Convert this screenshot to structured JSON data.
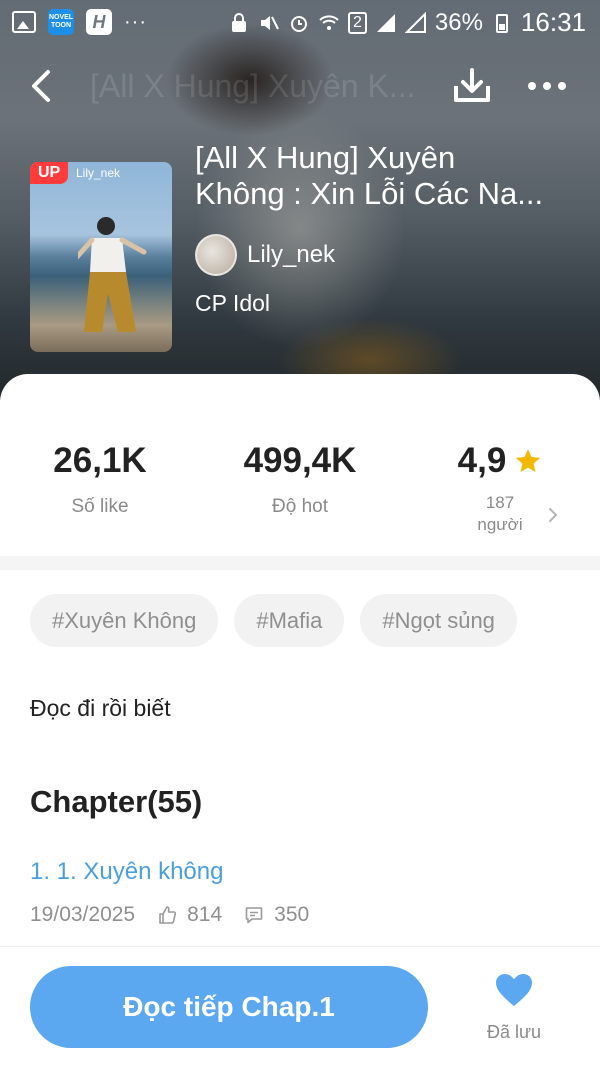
{
  "status_bar": {
    "app_icons": [
      "gallery-icon",
      "novel-toon-icon",
      "h-app-icon"
    ],
    "novel_toon_text": "NOVEL TOON",
    "h_app_text": "H",
    "more_dots": "···",
    "sim_slot": "2",
    "battery_percent": "36%",
    "time": "16:31"
  },
  "nav": {
    "title": "[All X Hung] Xuyên K..."
  },
  "book": {
    "cover_badge": "UP",
    "cover_author": "Lily_nek",
    "title_line1": "[All X Hung] Xuyên",
    "title_line2": "Không : Xin Lỗi Các Na...",
    "author": "Lily_nek",
    "category": "CP Idol"
  },
  "stats": {
    "likes": {
      "value": "26,1K",
      "label": "Số like"
    },
    "hot": {
      "value": "499,4K",
      "label": "Độ hot"
    },
    "rating": {
      "value": "4,9",
      "count": "187",
      "count_label": "người"
    }
  },
  "tags": [
    "#Xuyên Không",
    "#Mafia",
    "#Ngọt sủng"
  ],
  "description": "Đọc đi rồi biết",
  "chapters": {
    "heading": "Chapter(55)",
    "latest": {
      "title": "1. 1. Xuyên không",
      "date": "19/03/2025",
      "likes": "814",
      "comments": "350"
    }
  },
  "bottom": {
    "read_button": "Đọc tiếp Chap.1",
    "saved_label": "Đã lưu"
  },
  "colors": {
    "accent": "#5ba7f0",
    "link": "#4a9fe0",
    "badge": "#ff3b3b",
    "star": "#f5b800"
  }
}
